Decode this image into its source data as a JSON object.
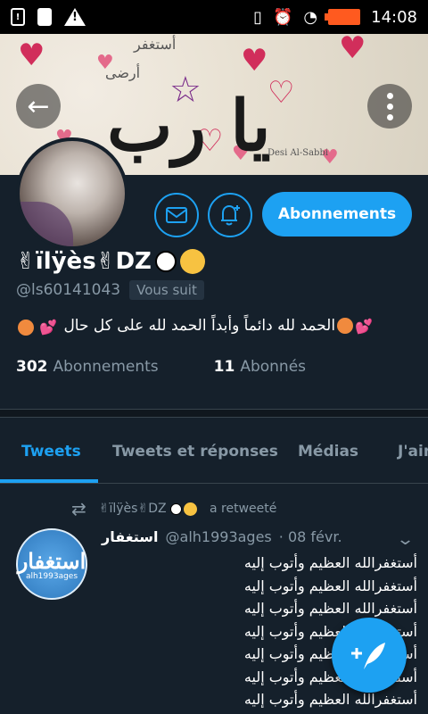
{
  "status_bar": {
    "time": "14:08",
    "battery_color": "#ff5a1f"
  },
  "banner": {
    "main_text": "يا رب",
    "small_text_1": "أستغفر",
    "small_text_2": "أرضى",
    "signature": "Desi Al-Sabbi"
  },
  "profile": {
    "display_name": "✌ïlÿès✌DZ",
    "handle": "@ls60141043",
    "follows_you_label": "Vous suit",
    "bio": "الحمد لله دائماً وأبداً الحمد لله على كل حال",
    "follow_button_label": "Abonnements",
    "stats": {
      "following_count": "302",
      "following_label": "Abonnements",
      "followers_count": "11",
      "followers_label": "Abonnés"
    }
  },
  "tabs": [
    {
      "label": "Tweets",
      "active": true
    },
    {
      "label": "Tweets et réponses",
      "active": false
    },
    {
      "label": "Médias",
      "active": false
    },
    {
      "label": "J'aime",
      "active": false
    }
  ],
  "retweet_banner": {
    "user": "✌ïlÿès✌DZ",
    "text": "a retweeté"
  },
  "tweet": {
    "avatar_main": "استغفار",
    "avatar_sub": "alh1993ages",
    "author": "استغفار",
    "handle": "@alh1993ages",
    "date": "· 08 févr.",
    "lines": [
      "أستغفرالله العظيم وأتوب إليه",
      "أستغفرالله العظيم وأتوب إليه",
      "أستغفرالله العظيم وأتوب إليه",
      "أستغفرالله العظيم وأتوب إليه",
      "أستغفرالله العظيم وأتوب إليه",
      "أستغفرالله العظيم وأتوب إليه",
      "أستغفرالله العظيم وأتوب إليه"
    ]
  },
  "colors": {
    "background": "#15202b",
    "accent": "#1da1f2",
    "secondary_text": "#8899a6"
  }
}
